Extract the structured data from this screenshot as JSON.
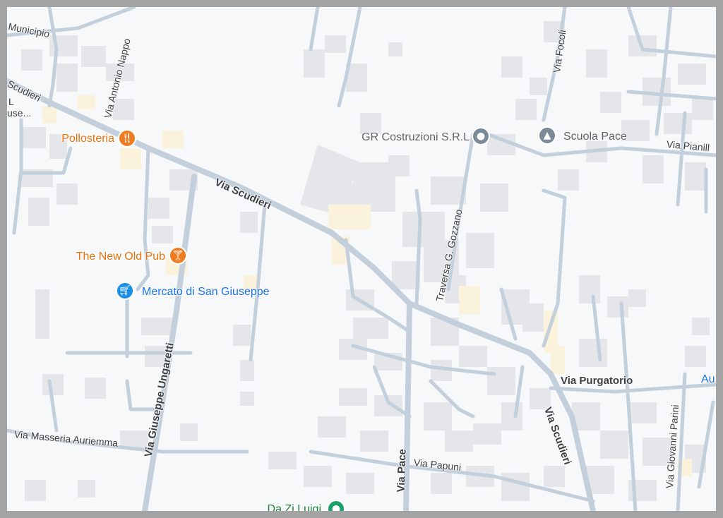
{
  "map": {
    "colors": {
      "background": "#f7f8f9",
      "road": "#c3cfdb",
      "building": "#e4e6ea",
      "highlight_building": "#fbf2dc",
      "food_poi": "#e8710a",
      "shop_poi": "#1a73e8",
      "generic_poi": "#5f6368",
      "park_poi": "#188038"
    },
    "road_labels": {
      "municipio": "Municipio",
      "via_antonio_nappo": "Via Antonio Nappo",
      "via_scudieri_nw": "Via Scudieri",
      "via_scudieri_main": "Via Scudieri",
      "via_scudieri_se": "Via Scudieri",
      "traversa_gozzano": "Traversa G. Gozzano",
      "via_focoli": "Via Focoli",
      "via_pianill": "Via Pianill",
      "via_purgatorio": "Via Purgatorio",
      "via_giuseppe_ungaretti": "Via Giuseppe Ungaretti",
      "via_masseria_auriemma": "Via Masseria Auriemma",
      "via_pace": "Via Pace",
      "via_papuni": "Via Papuni",
      "via_giovanni_parini": "Via Giovanni Parini",
      "partial_l": "L",
      "partial_use": "use...",
      "partial_au": "Au"
    },
    "pois": [
      {
        "name": "Pollosteria",
        "category": "restaurant",
        "icon": "fork-knife-icon"
      },
      {
        "name": "The New Old Pub",
        "category": "bar",
        "icon": "cocktail-icon"
      },
      {
        "name": "Mercato di San Giuseppe",
        "category": "shopping",
        "icon": "shopping-cart-icon"
      },
      {
        "name": "GR Costruzioni S.R.L",
        "category": "business",
        "icon": "location-pin-icon"
      },
      {
        "name": "Scuola Pace",
        "category": "school",
        "icon": "graduation-cap-icon"
      },
      {
        "name": "Da Zi Luigi",
        "category": "place",
        "icon": "location-pin-icon"
      }
    ]
  }
}
